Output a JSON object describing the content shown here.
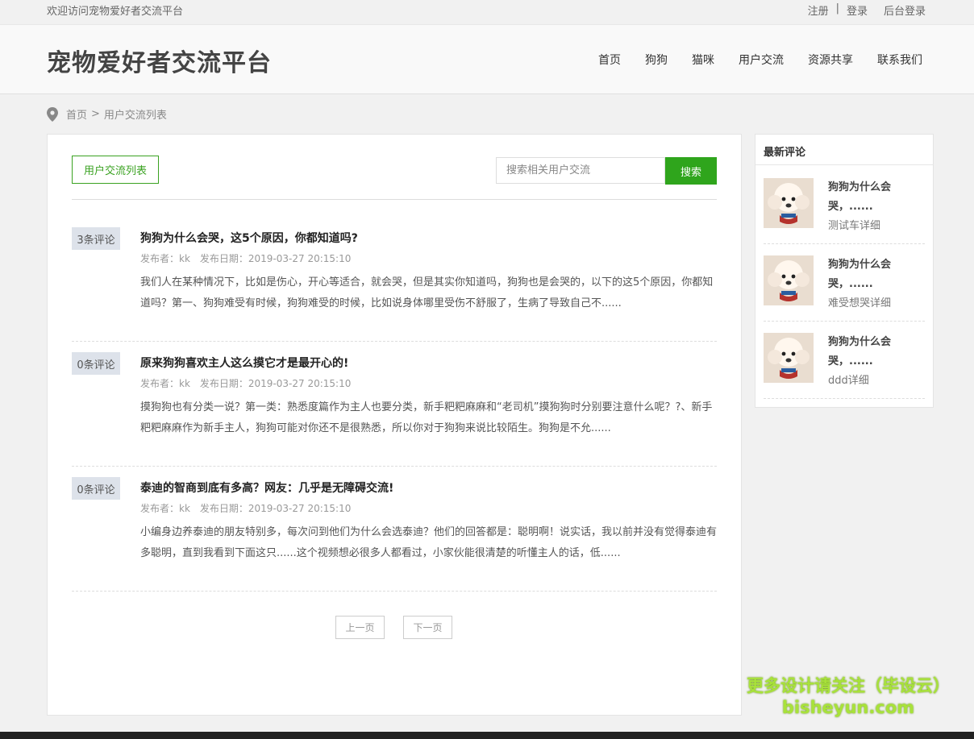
{
  "topbar": {
    "welcome": "欢迎访问宠物爱好者交流平台",
    "register": "注册",
    "separator": "|",
    "login": "登录",
    "admin_login": "后台登录"
  },
  "header": {
    "logo": "宠物爱好者交流平台",
    "nav": [
      "首页",
      "狗狗",
      "猫咪",
      "用户交流",
      "资源共享",
      "联系我们"
    ]
  },
  "breadcrumb": {
    "home": "首页",
    "arrow": ">",
    "current": "用户交流列表"
  },
  "main": {
    "tab_label": "用户交流列表",
    "search": {
      "placeholder": "搜索相关用户交流",
      "button": "搜索"
    },
    "posts": [
      {
        "comments": "3条评论",
        "title": "狗狗为什么会哭，这5个原因，你都知道吗?",
        "author": "发布者：kk",
        "date": "发布日期：2019-03-27 20:15:10",
        "excerpt": "我们人在某种情况下，比如是伤心，开心等适合，就会哭，但是其实你知道吗，狗狗也是会哭的，以下的这5个原因，你都知道吗？第一、狗狗难受有时候，狗狗难受的时候，比如说身体哪里受伤不舒服了，生病了导致自己不......"
      },
      {
        "comments": "0条评论",
        "title": "原来狗狗喜欢主人这么摸它才是最开心的!",
        "author": "发布者：kk",
        "date": "发布日期：2019-03-27 20:15:10",
        "excerpt": "摸狗狗也有分类一说？第一类：熟悉度篇作为主人也要分类，新手粑粑麻麻和“老司机”摸狗狗时分别要注意什么呢？?、新手粑粑麻麻作为新手主人，狗狗可能对你还不是很熟悉，所以你对于狗狗来说比较陌生。狗狗是不允......"
      },
      {
        "comments": "0条评论",
        "title": "泰迪的智商到底有多高？网友：几乎是无障碍交流!",
        "author": "发布者：kk",
        "date": "发布日期：2019-03-27 20:15:10",
        "excerpt": "小编身边养泰迪的朋友特别多，每次问到他们为什么会选泰迪？他们的回答都是：聪明啊！说实话，我以前并没有觉得泰迪有多聪明，直到我看到下面这只......这个视频想必很多人都看过，小家伙能很清楚的听懂主人的话，低......"
      }
    ],
    "pager": {
      "prev": "上一页",
      "next": "下一页"
    }
  },
  "sidebar": {
    "title": "最新评论",
    "items": [
      {
        "title_line1": "狗狗为什么会",
        "title_line2": "哭，......",
        "desc": "测试车详细"
      },
      {
        "title_line1": "狗狗为什么会",
        "title_line2": "哭，......",
        "desc": "难受想哭详细"
      },
      {
        "title_line1": "狗狗为什么会",
        "title_line2": "哭，......",
        "desc": "ddd详细"
      }
    ]
  },
  "watermark": {
    "line1": "更多设计请关注（毕设云）",
    "line2": "bisheyun.com"
  },
  "colors": {
    "accent": "#2fa51c",
    "badge_bg": "#dde2ea",
    "footer": "#222222"
  }
}
